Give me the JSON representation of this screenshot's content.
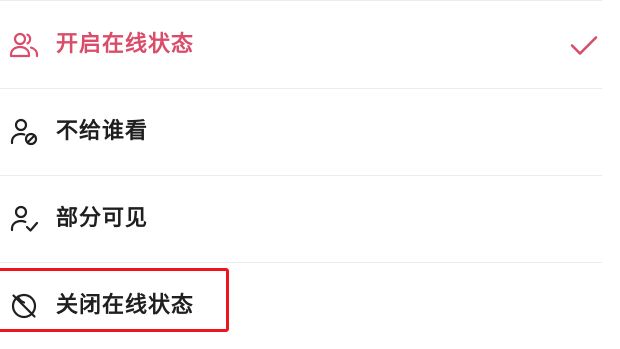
{
  "menu": {
    "items": [
      {
        "label": "开启在线状态",
        "icon": "friends-icon",
        "selected": true
      },
      {
        "label": "不给谁看",
        "icon": "person-block-icon",
        "selected": false
      },
      {
        "label": "部分可见",
        "icon": "person-check-icon",
        "selected": false
      },
      {
        "label": "关闭在线状态",
        "icon": "status-off-icon",
        "selected": false
      }
    ],
    "check_icon": "checkmark-icon"
  },
  "colors": {
    "accent": "#d94d6a",
    "text": "#1f1f1f",
    "divider": "#ececec",
    "highlight": "#f0141e"
  }
}
